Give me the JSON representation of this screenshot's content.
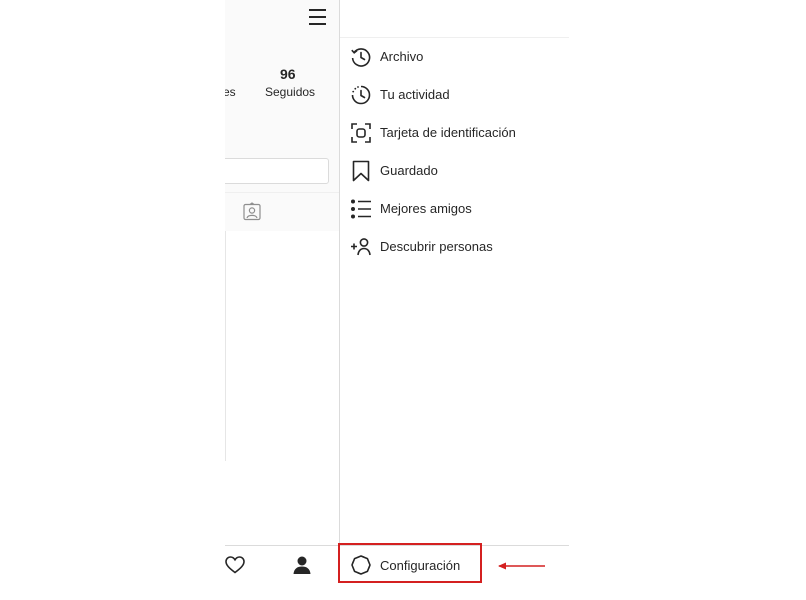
{
  "profile": {
    "followers_label_partial": "res",
    "following_count": "96",
    "following_label": "Seguidos"
  },
  "menu": {
    "items": [
      {
        "label": "Archivo",
        "icon": "archive-clock-icon"
      },
      {
        "label": "Tu actividad",
        "icon": "activity-clock-icon"
      },
      {
        "label": "Tarjeta de identificación",
        "icon": "nametag-icon"
      },
      {
        "label": "Guardado",
        "icon": "bookmark-icon"
      },
      {
        "label": "Mejores amigos",
        "icon": "close-friends-list-icon"
      },
      {
        "label": "Descubrir personas",
        "icon": "add-person-icon"
      }
    ],
    "settings_label": "Configuración",
    "settings_icon": "settings-gear-icon"
  },
  "annotation": {
    "highlight_color": "#d42020"
  }
}
